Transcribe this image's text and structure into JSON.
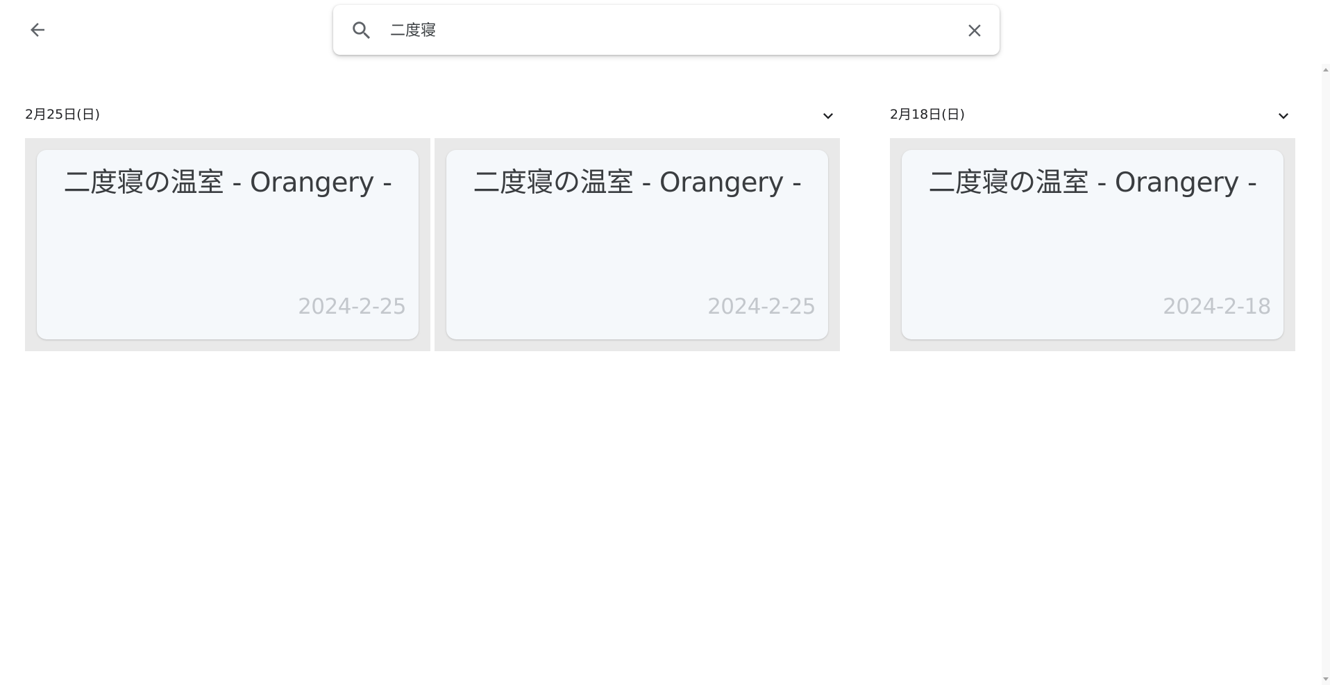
{
  "search": {
    "value": "二度寝",
    "placeholder": ""
  },
  "icons": {
    "back": "arrow-back-icon",
    "search": "search-icon",
    "clear": "close-icon",
    "expand": "chevron-down-icon"
  },
  "groups": [
    {
      "date_label": "2月25日(日)",
      "cards": [
        {
          "title": "二度寝の温室 - Orangery -",
          "date": "2024-2-25"
        },
        {
          "title": "二度寝の温室 - Orangery -",
          "date": "2024-2-25"
        }
      ]
    },
    {
      "date_label": "2月18日(日)",
      "cards": [
        {
          "title": "二度寝の温室 - Orangery -",
          "date": "2024-2-18"
        }
      ]
    }
  ]
}
